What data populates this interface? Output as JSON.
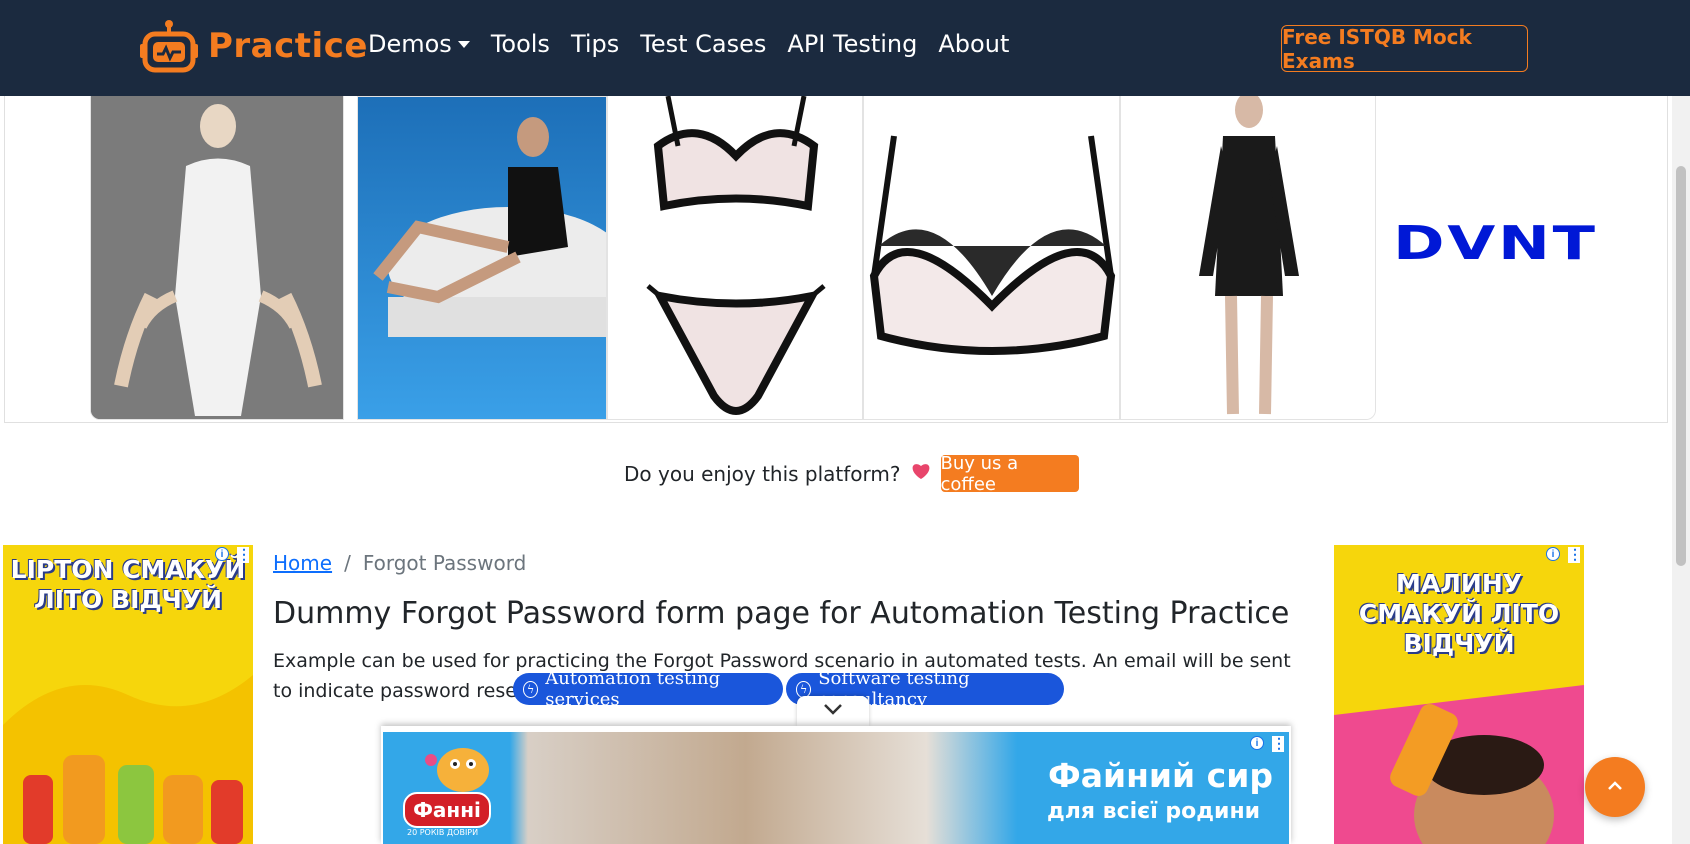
{
  "navbar": {
    "brand": "Practice",
    "links": [
      "Demos",
      "Tools",
      "Tips",
      "Test Cases",
      "API Testing",
      "About"
    ],
    "cta": "Free ISTQB Mock Exams",
    "colors": {
      "background": "#1b2a3f",
      "accent": "#f47c20"
    }
  },
  "ad_strip": {
    "logo_text": "DVNT"
  },
  "donate": {
    "question": "Do you enjoy this platform?",
    "heart": "💗",
    "button": "Buy us a coffee"
  },
  "left_ad": {
    "headline": "LIPTON СМАКУЙ ЛІТО ВІДЧУЙ"
  },
  "right_ad": {
    "headline": "МАЛИНУ СМАКУЙ ЛІТО ВІДЧУЙ"
  },
  "breadcrumb": {
    "home": "Home",
    "separator": "/",
    "current": "Forgot Password"
  },
  "main": {
    "title": "Dummy Forgot Password form page for Automation Testing Practice",
    "description": "Example can be used for practicing the Forgot Password scenario in automated tests. An email will be sent to indicate password reset instructions",
    "pills": [
      "Automation testing services",
      "Software testing consultancy"
    ]
  },
  "anchor_ad": {
    "brand": "Фанні",
    "brand_sub": "20 РОКІВ ДОВІРИ",
    "headline": "Файний сир",
    "tagline": "для всієї родини"
  },
  "ad_controls": {
    "info": "i",
    "menu": "⋮"
  }
}
